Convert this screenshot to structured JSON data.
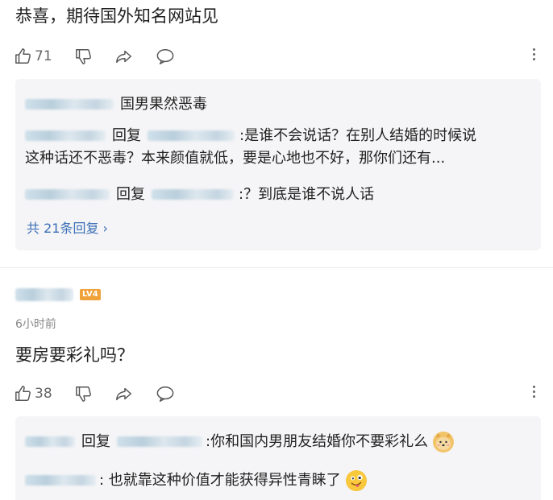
{
  "comment1": {
    "text": "恭喜，期待国外知名网站见",
    "likes": "71",
    "replies": [
      {
        "text": "国男果然恶毒"
      },
      {
        "reply_word": "回复",
        "line1": ":是谁不会说话？在别人结婚的时候说",
        "line2": "这种话还不恶毒？本来颜值就低，要是心地也不好，那你们还有..."
      },
      {
        "reply_word": "回复",
        "text": ":？到底是谁不说人话"
      }
    ],
    "more_replies": "共 21条回复 ›"
  },
  "comment2": {
    "level": "LV4",
    "time": "6小时前",
    "text": "要房要彩礼吗？",
    "likes": "38",
    "replies": [
      {
        "reply_word": "回复",
        "text": ":你和国内男朋友结婚你不要彩礼么",
        "emoji": "doge-emoji"
      },
      {
        "text": ": 也就靠这种价值才能获得异性青睐了",
        "emoji": "tongue-face-emoji"
      }
    ]
  },
  "colors": {
    "link": "#3b6fb6",
    "level_badge": "#f0a23a",
    "reply_bg": "#f5f5f7"
  }
}
